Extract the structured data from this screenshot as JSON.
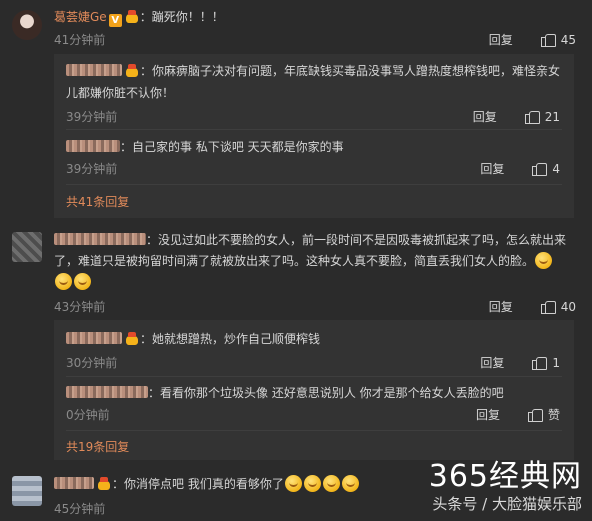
{
  "comments": [
    {
      "username": "葛荟婕Ge",
      "verified_badge": "V",
      "text": "蹦死你！！！",
      "time": "41分钟前",
      "reply_label": "回复",
      "likes": "45",
      "replies": [
        {
          "text": "你麻痹脑子决对有问题，年底缺钱买毒品没事骂人蹭热度想榨钱吧，难怪亲女儿都嫌你脏不认你！",
          "time": "39分钟前",
          "reply_label": "回复",
          "likes": "21"
        },
        {
          "text": "自己家的事 私下谈吧 天天都是你家的事",
          "time": "39分钟前",
          "reply_label": "回复",
          "likes": "4"
        }
      ],
      "more_replies": "共41条回复"
    },
    {
      "text": "没见过如此不要脸的女人，前一段时间不是因吸毒被抓起来了吗，怎么就出来了，难道只是被拘留时间满了就被放出来了吗。这种女人真不要脸，简直丢我们女人的脸。",
      "time": "43分钟前",
      "reply_label": "回复",
      "likes": "40",
      "replies": [
        {
          "text": "她就想蹭热，炒作自己顺便榨钱",
          "time": "30分钟前",
          "reply_label": "回复",
          "likes": "1"
        },
        {
          "text": "看看你那个垃圾头像 还好意思说别人 你才是那个给女人丢脸的吧",
          "time": "0分钟前",
          "reply_label": "回复",
          "likes": "赞"
        }
      ],
      "more_replies": "共19条回复"
    },
    {
      "text": "你消停点吧 我们真的看够你了",
      "time": "45分钟前"
    }
  ],
  "watermark": {
    "brand": "365经典网",
    "source": "头条号 / 大脸猫娱乐部"
  }
}
